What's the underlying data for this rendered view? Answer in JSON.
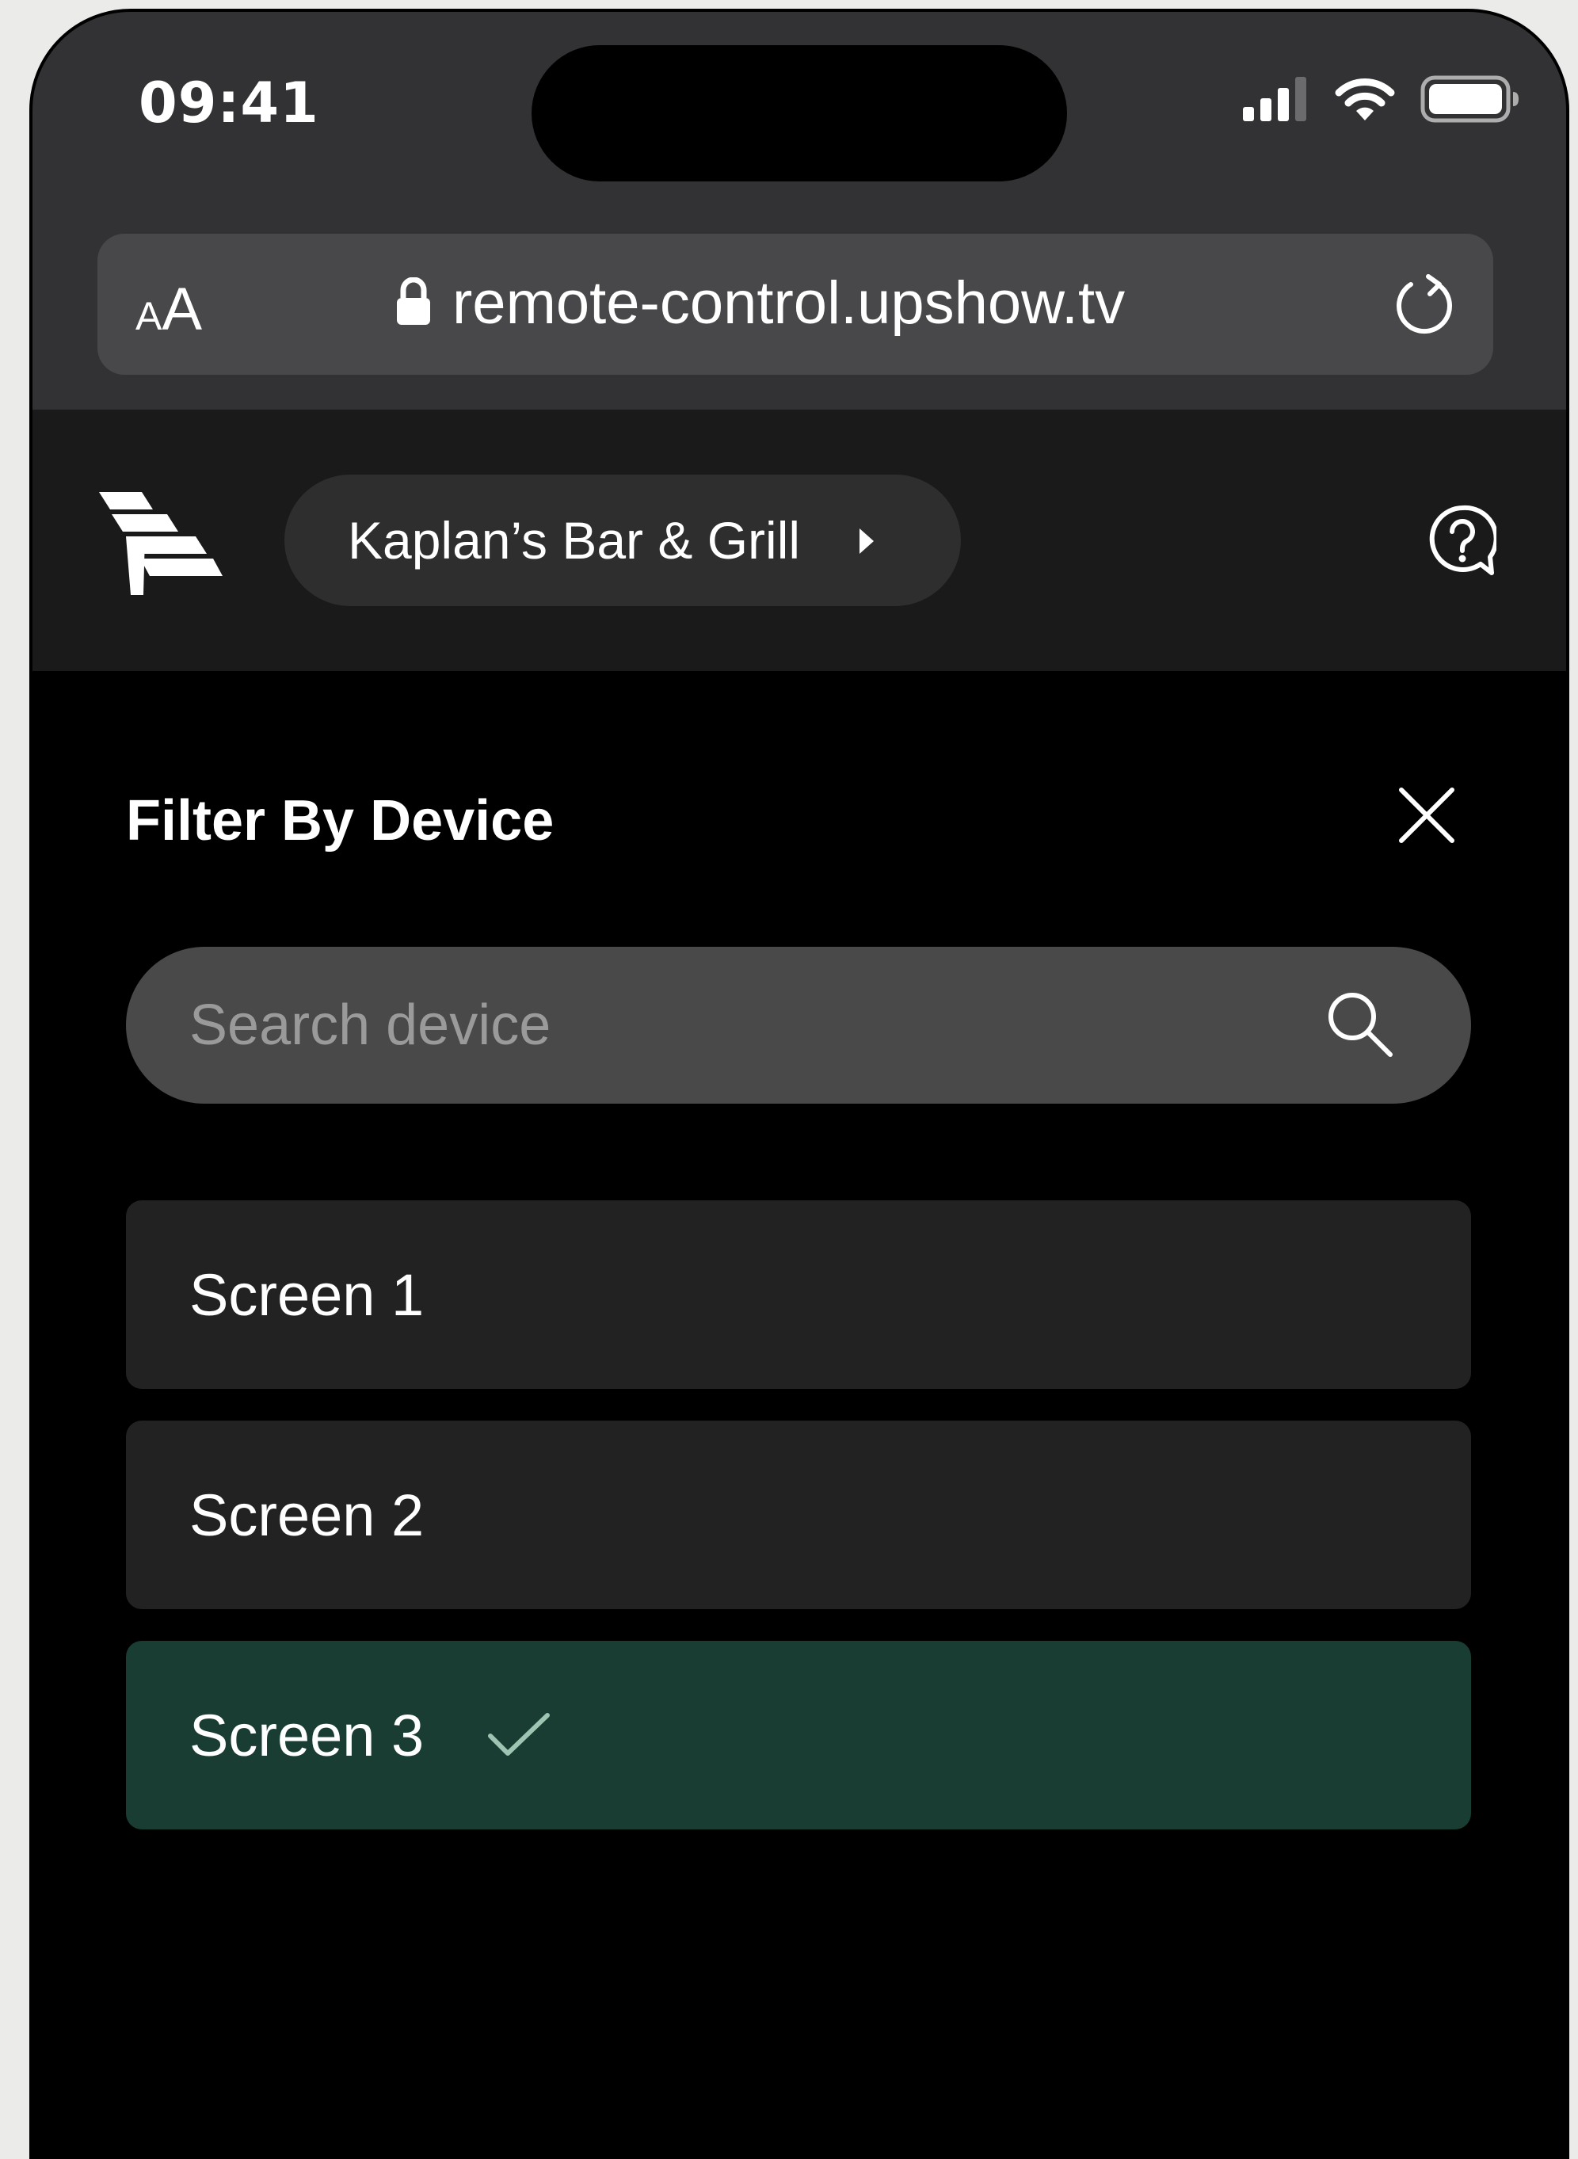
{
  "status_bar": {
    "time": "09:41",
    "icons": [
      "cellular-signal-icon",
      "wifi-icon",
      "battery-icon"
    ]
  },
  "browser": {
    "text_size_small": "A",
    "text_size_large": "A",
    "url": "remote-control.upshow.tv",
    "icons": [
      "lock-icon",
      "reload-icon"
    ]
  },
  "header": {
    "venue_name": "Kaplan’s Bar & Grill",
    "icons": [
      "upshow-logo-icon",
      "chevron-right-icon",
      "help-icon"
    ]
  },
  "filter_panel": {
    "title": "Filter By Device",
    "search_placeholder": "Search device",
    "search_value": "",
    "devices": [
      {
        "label": "Screen 1",
        "selected": false
      },
      {
        "label": "Screen 2",
        "selected": false
      },
      {
        "label": "Screen 3",
        "selected": true
      }
    ]
  },
  "colors": {
    "selected_background": "#1a3d33",
    "selected_check": "#9ec4b4",
    "item_background": "#222222",
    "search_background": "#494949"
  }
}
